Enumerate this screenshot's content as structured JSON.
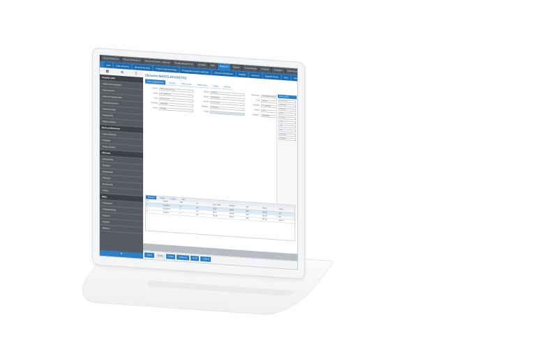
{
  "tabs": [
    "Strona Domowa",
    "Strona Domowa 2",
    "Strona Domowa – wykresy",
    "Środki specjalne (4)",
    "Dziedzic",
    "Pliki",
    "Magazyn",
    "Rejestr",
    "Komunikacja",
    "Projekty",
    "Analityka",
    "Dokumenty"
  ],
  "active_tab": 6,
  "nav": [
    "Lista",
    "Moje zlecenia",
    "Zlecenia łączone",
    "Pobierz dokumentację",
    "Przystanek danych ogólnych",
    "Zlecenia dodatkowe",
    "Dodatki",
    "Zmienne",
    "Dodatki strony",
    "Inne",
    "Historia"
  ],
  "sidebar": {
    "tools": [
      "▦",
      "⧉",
      "▯"
    ],
    "sections": [
      {
        "head": "Ostatnie pliki",
        "items": [
          "Faktura sprzedażowa",
          "Lista towarów",
          "Zlecenie magazynowe",
          "Lista dokumentów",
          "Inwentaryzacja",
          "Zestawienie",
          "Raport dzienny"
        ]
      },
      {
        "head": "Dane podstawowe",
        "items": [
          "Lista odbiorców",
          "Produkty",
          "Grupy cenowe"
        ]
      },
      {
        "head": "Zlecenia",
        "items": [
          "Zamówienia",
          "Dostawy",
          "Reklamacje",
          "Płatności",
          "Rozliczenia",
          "Zwroty"
        ]
      },
      {
        "head": "Moje",
        "items": [
          "Ustawienia",
          "Powiadomienia",
          "Zadania",
          "Historia",
          "Raporty"
        ]
      }
    ],
    "bottom": "▾"
  },
  "main": {
    "title": "Zlecenie MAZ/ZLEC/2017/11",
    "subtabs": [
      "Dane podstawowe",
      "Pozycje",
      "Zakres prac",
      "Dokumenty",
      "Uwagi",
      "Historia"
    ],
    "fields": [
      {
        "label": "Numer",
        "value": "MAZ/ZLEC/2017/11"
      },
      {
        "label": "Status",
        "value": "Otwarte"
      },
      {
        "label": "Kontrahent",
        "value": "Przedsiębiorstwo A"
      },
      {
        "label": "Adres",
        "value": "ul. Główna 12"
      },
      {
        "label": "Miasto",
        "value": "Warszawa"
      },
      {
        "label": "Kod",
        "value": "00-001"
      },
      {
        "label": "Data",
        "value": "2017-11-05"
      },
      {
        "label": "Termin",
        "value": "2017-11-20"
      },
      {
        "label": "Opiekun",
        "value": "J. Kowalski"
      },
      {
        "label": "Priorytet",
        "value": "Normalny"
      },
      {
        "label": "Magazyn",
        "value": "Centralny"
      },
      {
        "label": "Waluta",
        "value": "PLN"
      },
      {
        "label": "Forma",
        "value": "Przelew"
      },
      {
        "label": "Uwagi",
        "value": ""
      },
      {
        "label": "Kategoria",
        "value": "Standard"
      }
    ],
    "rightpanel": {
      "head": "Dane ogólne",
      "values": [
        "2017-11-05",
        "MAZ/001",
        "Aktywny",
        "PLN",
        "100,00",
        "23%",
        "Tak",
        "Nie",
        "Centralny",
        "Standard"
      ]
    },
    "table": {
      "tabs": [
        "Pozycje",
        "Usługi",
        "Koszty",
        "Pliki"
      ],
      "headers": [
        "Lp.",
        "Nazwa",
        "Ilość",
        "Jm",
        "Cena netto",
        "Wartość",
        "VAT",
        "Brutto",
        "Status"
      ],
      "rows": [
        [
          "1",
          "Produkt A",
          "10",
          "szt.",
          "12,50",
          "125,00",
          "23%",
          "153,75",
          "OK"
        ],
        [
          "2",
          "Produkt B",
          "4",
          "szt.",
          "40,00",
          "160,00",
          "23%",
          "196,80",
          "OK"
        ],
        [
          "3",
          "Usługa C",
          "1",
          "usł.",
          "250,00",
          "250,00",
          "23%",
          "307,50",
          "Nowa"
        ]
      ]
    },
    "footer": [
      "Zapisz",
      "Anuluj",
      "Drukuj",
      "Zatwierdź",
      "Wyślij",
      "Zamknij"
    ]
  }
}
